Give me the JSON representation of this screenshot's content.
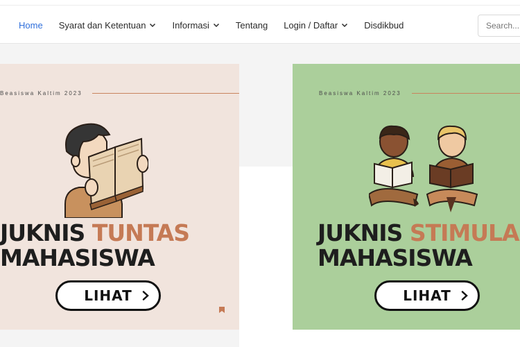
{
  "nav": {
    "items": [
      {
        "label": "Home",
        "active": true,
        "dropdown": false
      },
      {
        "label": "Syarat dan Ketentuan",
        "active": false,
        "dropdown": true
      },
      {
        "label": "Informasi",
        "active": false,
        "dropdown": true
      },
      {
        "label": "Tentang",
        "active": false,
        "dropdown": false
      },
      {
        "label": "Login / Daftar",
        "active": false,
        "dropdown": true
      },
      {
        "label": "Disdikbud",
        "active": false,
        "dropdown": false
      }
    ],
    "search_placeholder": "Search..."
  },
  "cards": [
    {
      "kicker": "Beasiswa Kaltim 2023",
      "title_part1": "JUKNIS ",
      "title_accent": "TUNTAS",
      "title_line2": "MAHASISWA",
      "button_label": "LIHAT",
      "background": "#f1e4dd"
    },
    {
      "kicker": "Beasiswa Kaltim 2023",
      "title_part1": "JUKNIS ",
      "title_accent": "STIMULAN",
      "title_line2": "MAHASISWA",
      "button_label": "LIHAT",
      "background": "#abcf9b"
    }
  ],
  "colors": {
    "active_link": "#2f6fdb",
    "accent_text": "#c57a55",
    "accent_line": "#c9845e"
  }
}
